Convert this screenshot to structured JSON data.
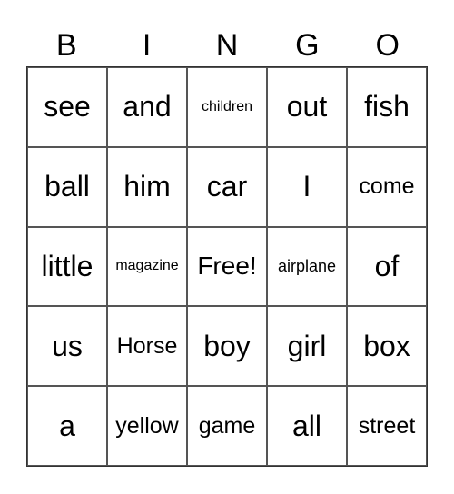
{
  "header": {
    "letters": [
      "B",
      "I",
      "N",
      "G",
      "O"
    ]
  },
  "rows": [
    [
      "see",
      "and",
      "children",
      "out",
      "fish"
    ],
    [
      "ball",
      "him",
      "car",
      "I",
      "come"
    ],
    [
      "little",
      "magazine",
      "Free!",
      "airplane",
      "of"
    ],
    [
      "us",
      "Horse",
      "boy",
      "girl",
      "box"
    ],
    [
      "a",
      "yellow",
      "game",
      "all",
      "street"
    ]
  ],
  "free_space_label": "Free!"
}
